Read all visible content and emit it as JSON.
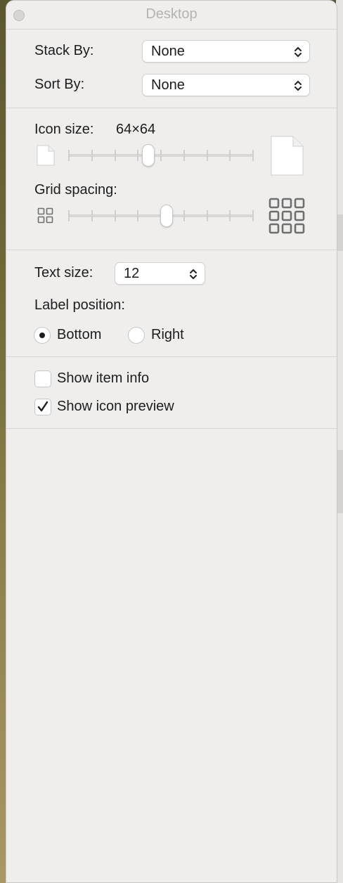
{
  "window": {
    "title": "Desktop"
  },
  "arrange": {
    "stack_by_label": "Stack By:",
    "stack_by_value": "None",
    "sort_by_label": "Sort By:",
    "sort_by_value": "None"
  },
  "icon_size": {
    "label": "Icon size:",
    "value_text": "64×64",
    "slider_level": 0.43
  },
  "grid_spacing": {
    "label": "Grid spacing:",
    "slider_level": 0.53
  },
  "text": {
    "size_label": "Text size:",
    "size_value": "12",
    "label_position_label": "Label position:",
    "options": [
      {
        "label": "Bottom",
        "selected": true
      },
      {
        "label": "Right",
        "selected": false
      }
    ]
  },
  "checkboxes": [
    {
      "label": "Show item info",
      "checked": false
    },
    {
      "label": "Show icon preview",
      "checked": true
    }
  ],
  "icons": {
    "close": "close-button",
    "small_doc": "small-document-icon",
    "large_doc": "large-document-icon",
    "small_grid": "small-grid-icon",
    "large_grid": "large-grid-icon"
  }
}
